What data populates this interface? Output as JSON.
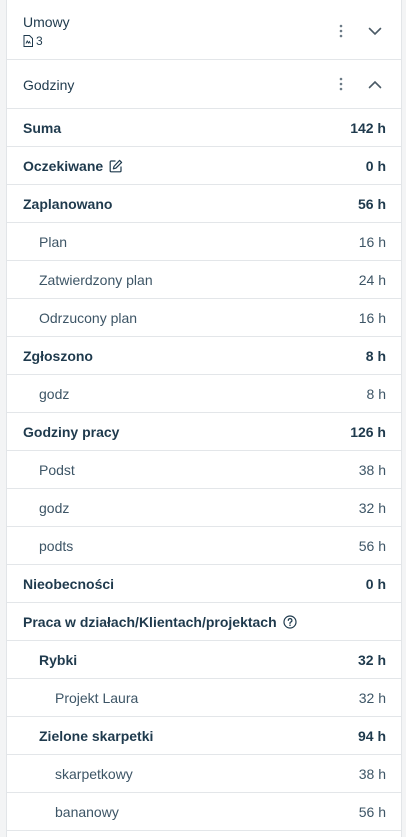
{
  "umowy": {
    "title": "Umowy",
    "doc_count": "3"
  },
  "godziny": {
    "title": "Godziny",
    "rows": [
      {
        "label": "Suma",
        "value": "142 h",
        "level": "l0"
      },
      {
        "label": "Oczekiwane",
        "value": "0 h",
        "level": "l0",
        "icon": "edit-icon"
      },
      {
        "label": "Zaplanowano",
        "value": "56 h",
        "level": "l0"
      },
      {
        "label": "Plan",
        "value": "16 h",
        "level": "l1"
      },
      {
        "label": "Zatwierdzony plan",
        "value": "24 h",
        "level": "l1"
      },
      {
        "label": "Odrzucony plan",
        "value": "16 h",
        "level": "l1"
      },
      {
        "label": "Zgłoszono",
        "value": "8 h",
        "level": "l0"
      },
      {
        "label": "godz",
        "value": "8 h",
        "level": "l1"
      },
      {
        "label": "Godziny pracy",
        "value": "126 h",
        "level": "l0"
      },
      {
        "label": "Podst",
        "value": "38 h",
        "level": "l1"
      },
      {
        "label": "godz",
        "value": "32 h",
        "level": "l1"
      },
      {
        "label": "podts",
        "value": "56 h",
        "level": "l1"
      },
      {
        "label": "Nieobecności",
        "value": "0 h",
        "level": "l0"
      },
      {
        "label": "Praca w działach/Klientach/projektach",
        "value": "",
        "level": "l0",
        "icon": "help-circle-icon"
      },
      {
        "label": "Rybki",
        "value": "32 h",
        "level": "l1b"
      },
      {
        "label": "Projekt Laura",
        "value": "32 h",
        "level": "l2"
      },
      {
        "label": "Zielone skarpetki",
        "value": "94 h",
        "level": "l1b"
      },
      {
        "label": "skarpetkowy",
        "value": "38 h",
        "level": "l2"
      },
      {
        "label": "bananowy",
        "value": "56 h",
        "level": "l2"
      }
    ]
  }
}
